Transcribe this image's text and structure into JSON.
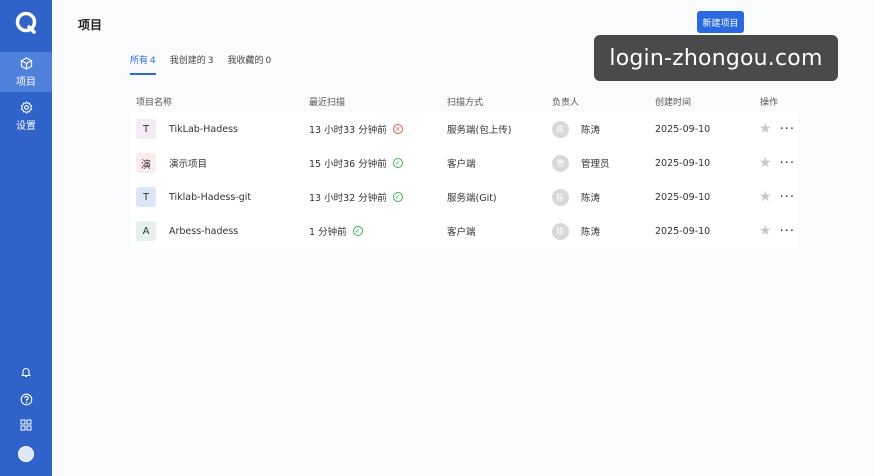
{
  "sidebar": {
    "logo_icon": "logo-ring-icon",
    "items": [
      {
        "label": "项目",
        "icon": "cube-icon",
        "active": true
      },
      {
        "label": "设置",
        "icon": "gear-icon",
        "active": false
      }
    ],
    "bottom_icons": [
      "bell-icon",
      "help-icon",
      "grid-icon",
      "avatar"
    ]
  },
  "header": {
    "title": "项目",
    "new_button": "新建项目"
  },
  "tabs": [
    {
      "label": "所有",
      "count": "4",
      "active": true
    },
    {
      "label": "我创建的",
      "count": "3",
      "active": false
    },
    {
      "label": "我收藏的",
      "count": "0",
      "active": false
    }
  ],
  "watermark": "login-zhongou.com",
  "table": {
    "columns": [
      "项目名称",
      "最近扫描",
      "扫描方式",
      "负责人",
      "创建时间",
      "操作"
    ],
    "rows": [
      {
        "icon_letter": "T",
        "icon_bg": "#f3ecf5",
        "name": "TikLab-Hadess",
        "scan": "13 小时33 分钟前",
        "status": "fail",
        "method": "服务端(包上传)",
        "avatar": "陈",
        "owner": "陈涛",
        "created": "2025-09-10"
      },
      {
        "icon_letter": "演",
        "icon_bg": "#fbecee",
        "name": "演示项目",
        "scan": "15 小时36 分钟前",
        "status": "ok",
        "method": "客户端",
        "avatar": "管",
        "owner": "管理员",
        "created": "2025-09-10"
      },
      {
        "icon_letter": "T",
        "icon_bg": "#dde6f7",
        "name": "Tiklab-Hadess-git",
        "scan": "13 小时32 分钟前",
        "status": "ok",
        "method": "服务端(Git)",
        "avatar": "陈",
        "owner": "陈涛",
        "created": "2025-09-10"
      },
      {
        "icon_letter": "A",
        "icon_bg": "#e6f1ee",
        "name": "Arbess-hadess",
        "scan": "1 分钟前",
        "status": "ok",
        "method": "客户端",
        "avatar": "陈",
        "owner": "陈涛",
        "created": "2025-09-10"
      }
    ]
  },
  "colors": {
    "sidebar": "#2f63c9",
    "accent": "#2a6ae0",
    "fail": "#e05a5a",
    "ok": "#3fae5c"
  }
}
